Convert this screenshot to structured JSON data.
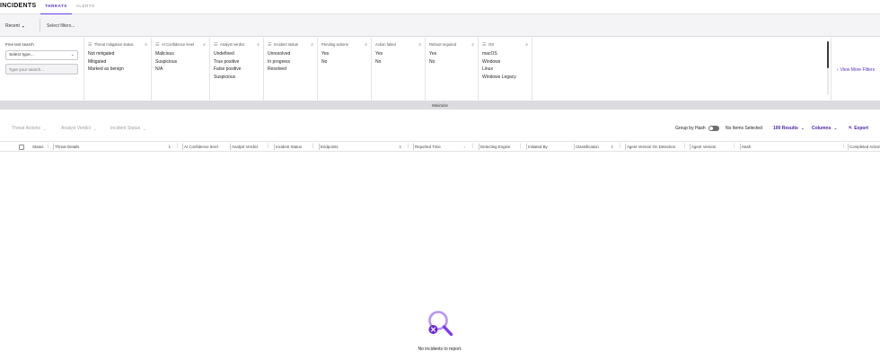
{
  "header": {
    "title": "INCIDENTS",
    "tabs": [
      {
        "label": "THREATS",
        "active": true
      },
      {
        "label": "ALERTS",
        "active": false
      }
    ]
  },
  "filter_bar": {
    "recent_label": "Recent",
    "filter_placeholder": "Select filters..."
  },
  "filters": {
    "free_text": {
      "label": "Free text search",
      "select_placeholder": "Select type...",
      "search_placeholder": "Type your search..."
    },
    "columns": [
      {
        "title": "Threat mitigation status",
        "options": [
          "Not mitigated",
          "Mitigated",
          "Marked as benign"
        ]
      },
      {
        "title": "AI Confidence level",
        "options": [
          "Malicious",
          "Suspicious",
          "N/A"
        ]
      },
      {
        "title": "Analyst verdict",
        "options": [
          "Undefined",
          "True positive",
          "False positive",
          "Suspicious"
        ]
      },
      {
        "title": "Incident status",
        "options": [
          "Unresolved",
          "In progress",
          "Resolved"
        ]
      },
      {
        "title": "Pending actions",
        "options": [
          "Yes",
          "No"
        ]
      },
      {
        "title": "Action failed",
        "options": [
          "Yes",
          "No"
        ]
      },
      {
        "title": "Reboot required",
        "options": [
          "Yes",
          "No"
        ]
      },
      {
        "title": "OS",
        "options": [
          "macOS",
          "Windows",
          "Linux",
          "Windows Legacy"
        ]
      }
    ],
    "view_more_label": "View More Filters",
    "minimize_label": "Minimize"
  },
  "toolbar": {
    "threat_actions": "Threat Actions",
    "analyst_verdict": "Analyst Verdict",
    "incident_status": "Incident Status",
    "group_by_hash": "Group by Hash",
    "selection_status": "No Items Selected",
    "results": "100 Results",
    "columns": "Columns",
    "export": "Export"
  },
  "table": {
    "headers": [
      "Status",
      "Threat Details",
      "AI Confidence level",
      "Analyst Verdict",
      "Incident Status",
      "Endpoints",
      "Reported Time",
      "Detecting Engine",
      "Initiated By",
      "Classification",
      "Agent Version On Detection",
      "Agent Version",
      "Hash",
      "Completed Actions"
    ]
  },
  "empty_state": {
    "message": "No incidents to report."
  },
  "colors": {
    "accent": "#6a3de8",
    "accent_dark": "#4b25a8",
    "icon_purple": "#8b5cf6"
  }
}
